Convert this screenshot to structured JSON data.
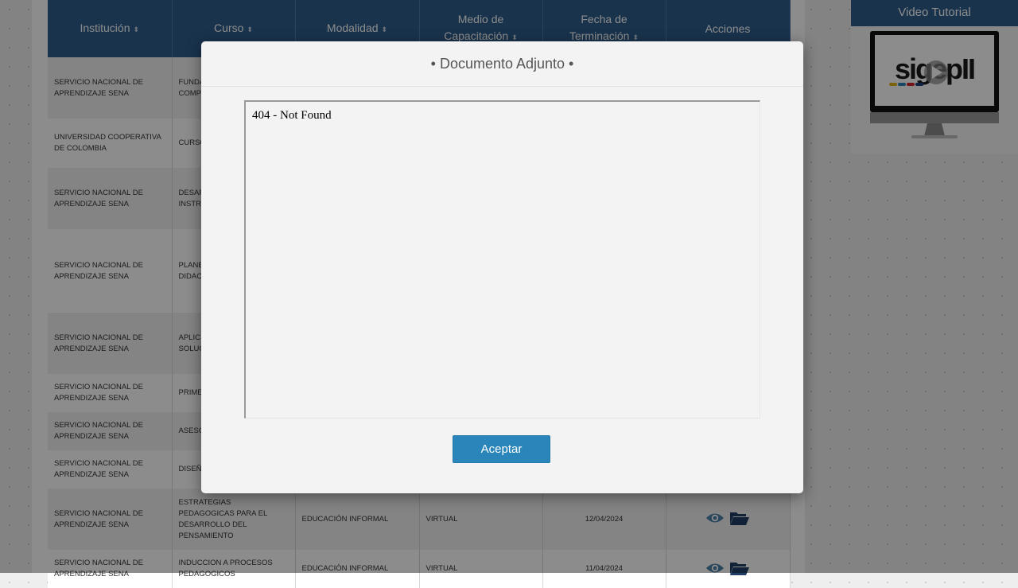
{
  "table": {
    "headers": [
      {
        "label": "Institución",
        "sortable": true
      },
      {
        "label": "Curso",
        "sortable": true
      },
      {
        "label": "Modalidad",
        "sortable": true
      },
      {
        "label": "Medio de Capacitación",
        "sortable": true
      },
      {
        "label": "Fecha de Terminación",
        "sortable": true
      },
      {
        "label": "Acciones",
        "sortable": false
      }
    ],
    "sort_icon": "⬍",
    "rows": [
      {
        "institucion": "SERVICIO NACIONAL DE APRENDIZAJE SENA",
        "curso": "FUNDA… FORM… INTEG… COMP…",
        "modalidad": "",
        "medio": "",
        "fecha": "",
        "show_actions": false
      },
      {
        "institucion": "UNIVERSIDAD COOPERATIVA DE COLOMBIA",
        "curso": "CURSO… INTEL…",
        "modalidad": "",
        "medio": "",
        "fecha": "",
        "show_actions": false
      },
      {
        "institucion": "SERVICIO NACIONAL DE APRENDIZAJE SENA",
        "curso": "DESAR… HABIL… DESEM… INSTR…",
        "modalidad": "",
        "medio": "",
        "fecha": "",
        "show_actions": false
      },
      {
        "institucion": "SERVICIO NACIONAL DE APRENDIZAJE SENA",
        "curso": "PLANE… ESTRA… PEDAG… DIDAC… FORMA… INTEG…",
        "modalidad": "",
        "medio": "",
        "fecha": "",
        "show_actions": false
      },
      {
        "institucion": "SERVICIO NACIONAL DE APRENDIZAJE SENA",
        "curso": "APLIC… Y COM… MULTI… SOLUC…",
        "modalidad": "",
        "medio": "",
        "fecha": "",
        "show_actions": false
      },
      {
        "institucion": "SERVICIO NACIONAL DE APRENDIZAJE SENA",
        "curso": "PRIME…",
        "modalidad": "",
        "medio": "",
        "fecha": "",
        "show_actions": false
      },
      {
        "institucion": "SERVICIO NACIONAL DE APRENDIZAJE SENA",
        "curso": "ASESO… LAS TI…",
        "modalidad": "",
        "medio": "",
        "fecha": "",
        "show_actions": false
      },
      {
        "institucion": "SERVICIO NACIONAL DE APRENDIZAJE SENA",
        "curso": "DISEÑ… DE EV…",
        "modalidad": "",
        "medio": "",
        "fecha": "",
        "show_actions": false
      },
      {
        "institucion": "SERVICIO NACIONAL DE APRENDIZAJE SENA",
        "curso": "ESTRATEGIAS PEDAGOGICAS PARA EL DESARROLLO DEL PENSAMIENTO",
        "modalidad": "EDUCACIÓN INFORMAL",
        "medio": "VIRTUAL",
        "fecha": "12/04/2024",
        "show_actions": true
      },
      {
        "institucion": "SERVICIO NACIONAL DE APRENDIZAJE SENA",
        "curso": "INDUCCION A PROCESOS PEDAGOGICOS",
        "modalidad": "EDUCACIÓN INFORMAL",
        "medio": "VIRTUAL",
        "fecha": "11/04/2024",
        "show_actions": true
      }
    ]
  },
  "sidebar": {
    "video_title": "Video Tutorial",
    "logo_text": "sigepII",
    "logo_colors": [
      "#e2b21d",
      "#2a86ba",
      "#d6262d",
      "#1d3f7a"
    ]
  },
  "modal": {
    "title": "• Documento Adjunto •",
    "document_text": "404 - Not Found",
    "accept_label": "Aceptar"
  },
  "colors": {
    "table_header": "#2e5d8c",
    "accent_button": "#2a86ba",
    "icon_eye": "#4b82a8",
    "icon_folder": "#1f3f66"
  }
}
